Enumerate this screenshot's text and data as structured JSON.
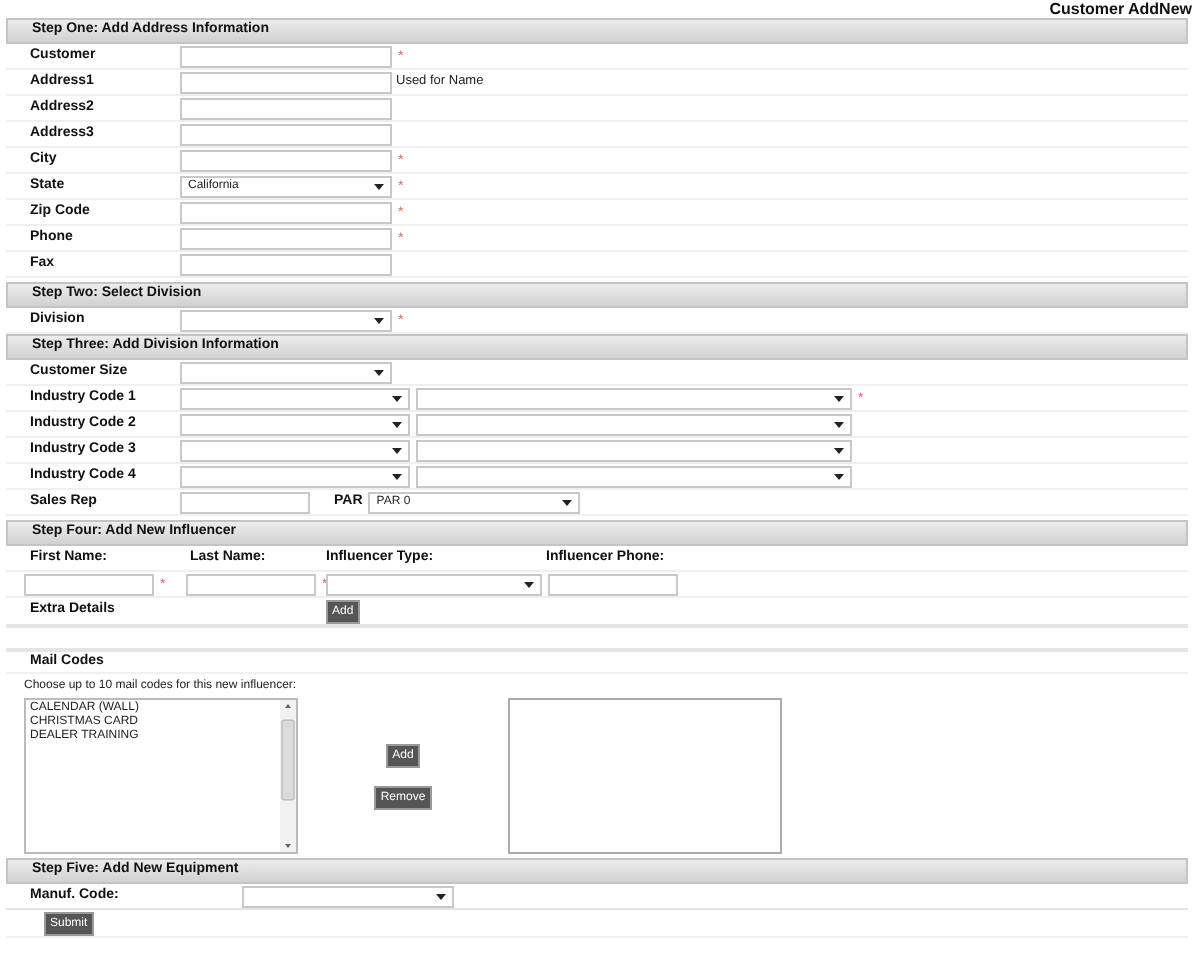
{
  "page_title": "Customer AddNew",
  "step_one": {
    "heading": "Step One: Add Address Information",
    "fields": [
      {
        "label": "Customer",
        "kind": "text",
        "mark": "*"
      },
      {
        "label": "Address1",
        "kind": "text",
        "note": "Used for Name"
      },
      {
        "label": "Address2",
        "kind": "text"
      },
      {
        "label": "Address3",
        "kind": "text"
      },
      {
        "label": "City",
        "kind": "text",
        "mark": "*"
      },
      {
        "label": "State",
        "kind": "select",
        "value": "California",
        "mark": "*"
      },
      {
        "label": "Zip Code",
        "kind": "text",
        "mark": "*"
      },
      {
        "label": "Phone",
        "kind": "text",
        "mark": "*"
      },
      {
        "label": "Fax",
        "kind": "text"
      }
    ]
  },
  "step_two": {
    "heading": "Step Two: Select Division",
    "fields": [
      {
        "label": "Division",
        "kind": "select",
        "mark": "*"
      }
    ]
  },
  "step_three": {
    "heading": "Step Three: Add Division Information",
    "fields": [
      {
        "label": "Customer Size",
        "kind": "select"
      },
      {
        "label": "Industry Code 1",
        "kind": "select_pair",
        "mark": "*"
      },
      {
        "label": "Industry Code 2",
        "kind": "select_pair"
      },
      {
        "label": "Industry Code 3",
        "kind": "select_pair"
      },
      {
        "label": "Industry Code 4",
        "kind": "select_pair"
      },
      {
        "label": "Sales Rep",
        "kind": "text_par",
        "par_label": "PAR",
        "par_value": "PAR 0"
      }
    ]
  },
  "step_four": {
    "heading": "Step Four: Add New Influencer",
    "columns": [
      {
        "label": "First Name:",
        "kind": "text",
        "mark": "*"
      },
      {
        "label": "Last Name:",
        "kind": "text",
        "mark": "*"
      },
      {
        "label": "Influencer Type:",
        "kind": "select"
      },
      {
        "label": "Influencer Phone:",
        "kind": "text"
      }
    ],
    "extra_details_label": "Extra Details",
    "add_button": "Add"
  },
  "mail_codes": {
    "heading": "Mail Codes",
    "instruction": "Choose up to 10 mail codes for this new influencer:",
    "available": [
      "CALENDAR (WALL)",
      "CHRISTMAS CARD",
      "DEALER TRAINING"
    ],
    "add_button": "Add",
    "remove_button": "Remove"
  },
  "step_five": {
    "heading": "Step Five: Add New Equipment",
    "fields": [
      {
        "label": "Manuf. Code:",
        "kind": "select"
      }
    ],
    "submit_button": "Submit"
  }
}
